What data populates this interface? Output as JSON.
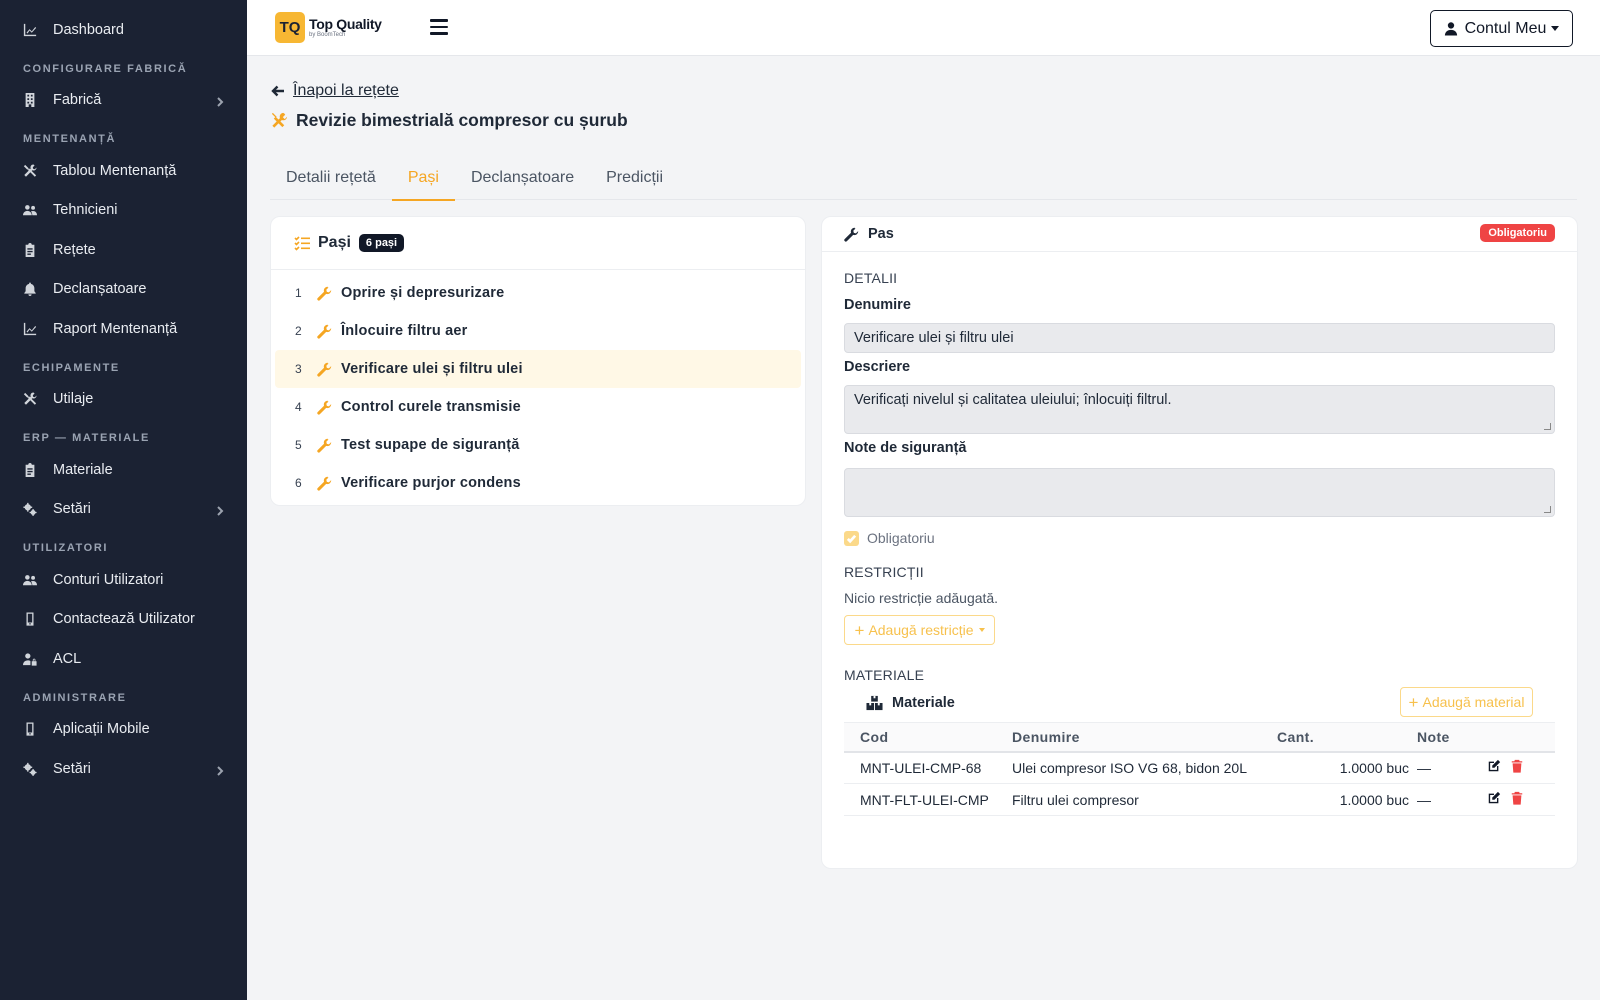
{
  "sidebar": {
    "items": [
      {
        "type": "item",
        "label": "Dashboard",
        "icon": "chart-line-icon"
      },
      {
        "type": "section",
        "label": "CONFIGURARE FABRICĂ"
      },
      {
        "type": "item",
        "label": "Fabrică",
        "icon": "building-icon",
        "chevron": true
      },
      {
        "type": "section",
        "label": "MENTENANȚĂ"
      },
      {
        "type": "item",
        "label": "Tablou Mentenanță",
        "icon": "tools-icon"
      },
      {
        "type": "item",
        "label": "Tehnicieni",
        "icon": "users-icon"
      },
      {
        "type": "item",
        "label": "Rețete",
        "icon": "clipboard-icon"
      },
      {
        "type": "item",
        "label": "Declanșatoare",
        "icon": "bell-icon"
      },
      {
        "type": "item",
        "label": "Raport Mentenanță",
        "icon": "chart-line-icon"
      },
      {
        "type": "section",
        "label": "ECHIPAMENTE"
      },
      {
        "type": "item",
        "label": "Utilaje",
        "icon": "tools-icon"
      },
      {
        "type": "section",
        "label": "ERP — MATERIALE"
      },
      {
        "type": "item",
        "label": "Materiale",
        "icon": "clipboard-icon"
      },
      {
        "type": "item",
        "label": "Setări",
        "icon": "cogs-icon",
        "chevron": true
      },
      {
        "type": "section",
        "label": "UTILIZATORI"
      },
      {
        "type": "item",
        "label": "Conturi Utilizatori",
        "icon": "users-icon"
      },
      {
        "type": "item",
        "label": "Contactează Utilizator",
        "icon": "mobile-icon"
      },
      {
        "type": "item",
        "label": "ACL",
        "icon": "user-lock-icon"
      },
      {
        "type": "section",
        "label": "ADMINISTRARE"
      },
      {
        "type": "item",
        "label": "Aplicații Mobile",
        "icon": "mobile-icon"
      },
      {
        "type": "item",
        "label": "Setări",
        "icon": "cogs-icon",
        "chevron": true
      }
    ]
  },
  "topbar": {
    "logo_mark": "TQ",
    "logo_title": "Top Quality",
    "logo_sub": "by BoomTech",
    "account_label": "Contul Meu"
  },
  "page": {
    "back_label": "Înapoi la rețete",
    "title": "Revizie bimestrială compresor cu șurub"
  },
  "tabs": [
    {
      "label": "Detalii rețetă",
      "active": false
    },
    {
      "label": "Pași",
      "active": true
    },
    {
      "label": "Declanșatoare",
      "active": false
    },
    {
      "label": "Predicții",
      "active": false
    }
  ],
  "steps": {
    "title": "Pași",
    "count_badge": "6 pași",
    "items": [
      {
        "num": "1",
        "label": "Oprire și depresurizare",
        "active": false
      },
      {
        "num": "2",
        "label": "Înlocuire filtru aer",
        "active": false
      },
      {
        "num": "3",
        "label": "Verificare ulei și filtru ulei",
        "active": true
      },
      {
        "num": "4",
        "label": "Control curele transmisie",
        "active": false
      },
      {
        "num": "5",
        "label": "Test supape de siguranță",
        "active": false
      },
      {
        "num": "6",
        "label": "Verificare purjor condens",
        "active": false
      }
    ]
  },
  "pas": {
    "title": "Pas",
    "badge": "Obligatoriu",
    "section_details": "DETALII",
    "name_label": "Denumire",
    "name_value": "Verificare ulei și filtru ulei",
    "desc_label": "Descriere",
    "desc_value": "Verificați nivelul și calitatea uleiului; înlocuiți filtrul.",
    "safety_label": "Note de siguranță",
    "safety_value": "",
    "mandatory_label": "Obligatoriu",
    "mandatory_checked": true,
    "section_restrictions": "RESTRICȚII",
    "no_restrictions": "Nicio restricție adăugată.",
    "add_restriction": "Adaugă restricție",
    "section_materials": "MATERIALE",
    "materials_title": "Materiale",
    "add_material": "Adaugă material",
    "columns": {
      "cod": "Cod",
      "den": "Denumire",
      "cant": "Cant.",
      "note": "Note"
    },
    "rows": [
      {
        "cod": "MNT-ULEI-CMP-68",
        "den": "Ulei compresor ISO VG 68, bidon 20L",
        "cant": "1.0000 buc",
        "note": "—"
      },
      {
        "cod": "MNT-FLT-ULEI-CMP",
        "den": "Filtru ulei compresor",
        "cant": "1.0000 buc",
        "note": "—"
      }
    ]
  },
  "colors": {
    "accent": "#f5a623",
    "sidebar_bg": "#1b2233",
    "danger": "#ef4444"
  }
}
